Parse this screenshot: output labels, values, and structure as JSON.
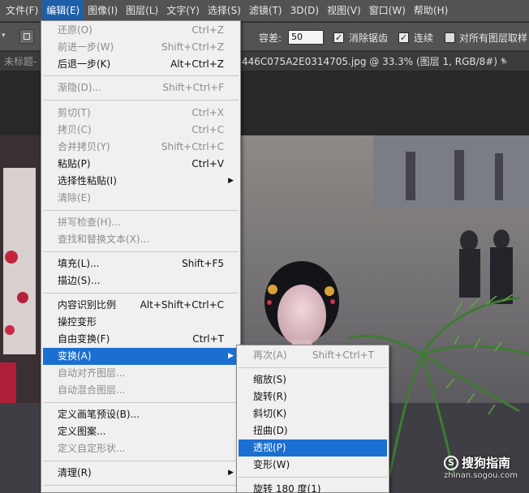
{
  "menubar": {
    "items": [
      "文件(F)",
      "编辑(E)",
      "图像(I)",
      "图层(L)",
      "文字(Y)",
      "选择(S)",
      "滤镜(T)",
      "3D(D)",
      "视图(V)",
      "窗口(W)",
      "帮助(H)"
    ]
  },
  "options": {
    "tolerance_label": "容差:",
    "tolerance_value": "50",
    "antialias_label": "消除锯齿",
    "contiguous_label": "连续",
    "sample_all_label": "对所有图层取样"
  },
  "tabs": {
    "first": "未标题-",
    "current": "446C075A2E0314705.jpg @ 33.3% (图层 1, RGB/8#) *"
  },
  "edit_menu": {
    "items": [
      {
        "label": "还原(O)",
        "shortcut": "Ctrl+Z",
        "disabled": true
      },
      {
        "label": "前进一步(W)",
        "shortcut": "Shift+Ctrl+Z",
        "disabled": true
      },
      {
        "label": "后退一步(K)",
        "shortcut": "Alt+Ctrl+Z",
        "disabled": false
      },
      {
        "label": "渐隐(D)...",
        "shortcut": "Shift+Ctrl+F",
        "disabled": true
      },
      {
        "label": "剪切(T)",
        "shortcut": "Ctrl+X",
        "disabled": true
      },
      {
        "label": "拷贝(C)",
        "shortcut": "Ctrl+C",
        "disabled": true
      },
      {
        "label": "合并拷贝(Y)",
        "shortcut": "Shift+Ctrl+C",
        "disabled": true
      },
      {
        "label": "粘贴(P)",
        "shortcut": "Ctrl+V",
        "disabled": false
      },
      {
        "label": "选择性粘贴(I)",
        "shortcut": "",
        "disabled": false
      },
      {
        "label": "清除(E)",
        "shortcut": "",
        "disabled": true
      },
      {
        "label": "拼写检查(H)...",
        "shortcut": "",
        "disabled": true
      },
      {
        "label": "查找和替换文本(X)...",
        "shortcut": "",
        "disabled": true
      },
      {
        "label": "填充(L)...",
        "shortcut": "Shift+F5",
        "disabled": false
      },
      {
        "label": "描边(S)...",
        "shortcut": "",
        "disabled": false
      },
      {
        "label": "内容识别比例",
        "shortcut": "Alt+Shift+Ctrl+C",
        "disabled": false
      },
      {
        "label": "操控变形",
        "shortcut": "",
        "disabled": false
      },
      {
        "label": "自由变换(F)",
        "shortcut": "Ctrl+T",
        "disabled": false
      },
      {
        "label": "变换(A)",
        "shortcut": "",
        "disabled": false
      },
      {
        "label": "自动对齐图层...",
        "shortcut": "",
        "disabled": true
      },
      {
        "label": "自动混合图层...",
        "shortcut": "",
        "disabled": true
      },
      {
        "label": "定义画笔预设(B)...",
        "shortcut": "",
        "disabled": false
      },
      {
        "label": "定义图案...",
        "shortcut": "",
        "disabled": false
      },
      {
        "label": "定义自定形状...",
        "shortcut": "",
        "disabled": true
      },
      {
        "label": "清理(R)",
        "shortcut": "",
        "disabled": false
      }
    ]
  },
  "transform_menu": {
    "items": [
      {
        "label": "再次(A)",
        "shortcut": "Shift+Ctrl+T",
        "disabled": true
      },
      {
        "label": "缩放(S)",
        "shortcut": ""
      },
      {
        "label": "旋转(R)",
        "shortcut": ""
      },
      {
        "label": "斜切(K)",
        "shortcut": ""
      },
      {
        "label": "扭曲(D)",
        "shortcut": ""
      },
      {
        "label": "透视(P)",
        "shortcut": ""
      },
      {
        "label": "变形(W)",
        "shortcut": ""
      },
      {
        "label": "旋转 180 度(1)",
        "shortcut": ""
      }
    ]
  },
  "watermark": {
    "logo": "搜狗指南",
    "url": "zhinan.sogou.com"
  },
  "colors": {
    "menu_highlight": "#1b6fd1",
    "menubar_active": "#1f5fa8"
  }
}
